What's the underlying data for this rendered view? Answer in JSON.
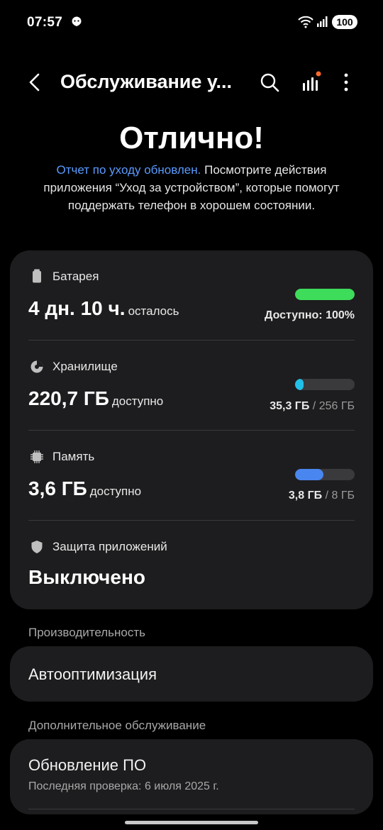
{
  "status_bar": {
    "time": "07:57",
    "battery": "100"
  },
  "app_bar": {
    "title": "Обслуживание у..."
  },
  "headline": "Отлично!",
  "description": {
    "link": "Отчет по уходу обновлен.",
    "text": " Посмотрите действия приложения “Уход за устройством”, которые помогут поддержать телефон в хорошем состоянии."
  },
  "battery": {
    "label": "Батарея",
    "value": "4 дн. 10 ч.",
    "suffix": "осталось",
    "status": "Доступно: 100%",
    "level": 1.0,
    "color": "#3ddc5a"
  },
  "storage": {
    "label": "Хранилище",
    "value": "220,7 ГБ",
    "suffix": "доступно",
    "used": "35,3 ГБ",
    "total": " / 256 ГБ",
    "level": 0.138,
    "color": "#22c0e8"
  },
  "memory": {
    "label": "Память",
    "value": "3,6 ГБ",
    "suffix": "доступно",
    "used": "3,8 ГБ",
    "total": " / 8 ГБ",
    "level": 0.475,
    "color": "#4a86f0"
  },
  "app_protection": {
    "label": "Защита приложений",
    "value": "Выключено"
  },
  "performance": {
    "section": "Производительность",
    "item": "Автооптимизация"
  },
  "additional": {
    "section": "Дополнительное обслуживание",
    "item": "Обновление ПО",
    "subtitle": "Последняя проверка: 6 июля 2025 г."
  }
}
